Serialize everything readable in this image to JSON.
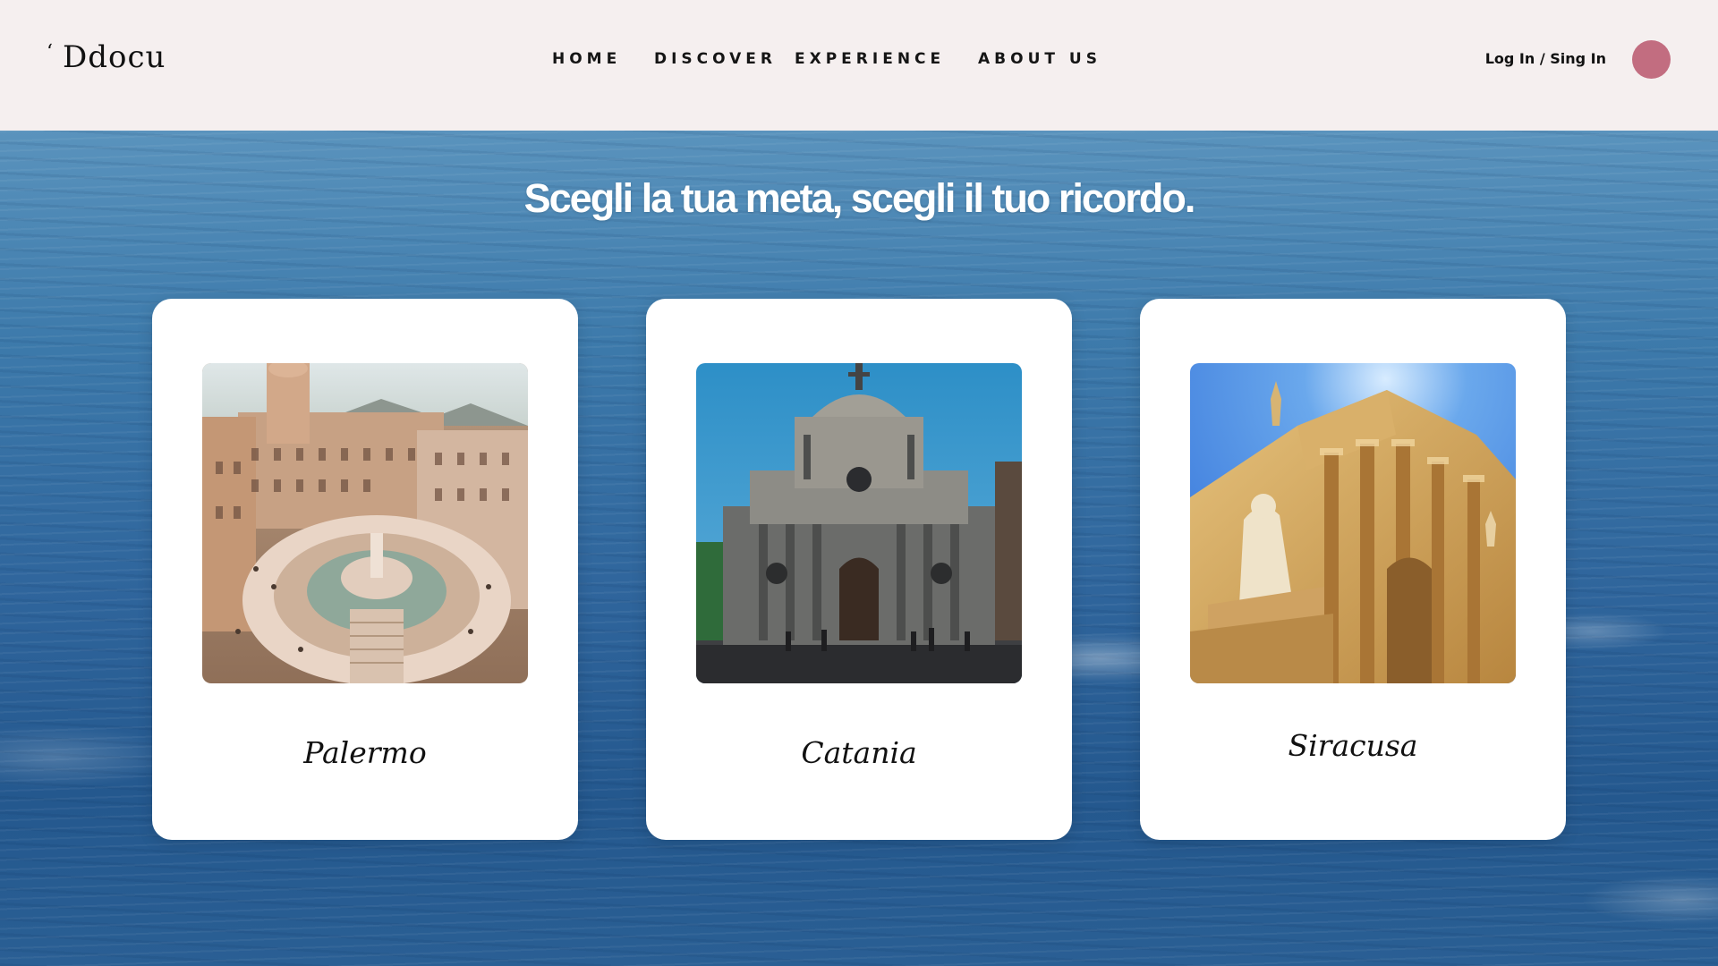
{
  "header": {
    "logo": {
      "mark": "‘",
      "text": "Ddocu"
    },
    "nav": [
      {
        "label": "HOME"
      },
      {
        "label": "DISCOVER"
      },
      {
        "label": "EXPERIENCE"
      },
      {
        "label": "ABOUT US"
      }
    ],
    "login_label": "Log In / Sing In",
    "avatar_color": "#c26d80"
  },
  "main": {
    "headline": "Scegli la tua meta, scegli il tuo ricordo.",
    "cards": [
      {
        "label": "Palermo",
        "image": "palermo-fountain-photo"
      },
      {
        "label": "Catania",
        "image": "catania-cathedral-photo"
      },
      {
        "label": "Siracusa",
        "image": "siracusa-cathedral-photo"
      }
    ]
  },
  "colors": {
    "header_bg": "#f5efef",
    "ocean": "#2f659c",
    "card_bg": "#ffffff"
  }
}
